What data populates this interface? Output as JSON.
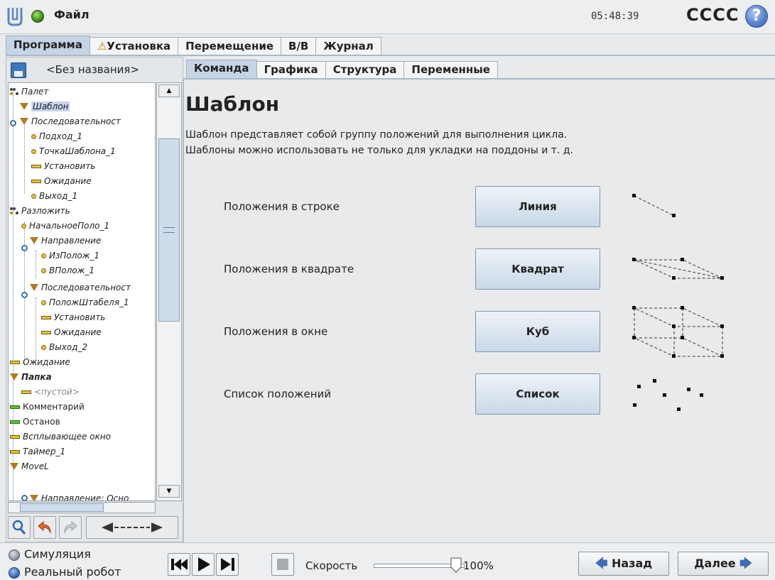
{
  "topbar": {
    "file_menu": "Файл",
    "clock": "05:48:39",
    "robot_name": "CCCC",
    "help": "?"
  },
  "main_tabs": [
    {
      "label": "Программа",
      "active": true
    },
    {
      "label": "Установка",
      "warning": true
    },
    {
      "label": "Перемещение"
    },
    {
      "label": "В/В"
    },
    {
      "label": "Журнал"
    }
  ],
  "program": {
    "name": "<Без названия>"
  },
  "tree": [
    {
      "label": "Палет",
      "icon": "pallet-icon"
    },
    {
      "label": "Шаблон",
      "icon": "folder-triangle-icon",
      "selected": true
    },
    {
      "label": "Последовательност",
      "icon": "folder-triangle-icon"
    },
    {
      "label": "Подход_1",
      "icon": "waypoint-icon"
    },
    {
      "label": "ТочкаШаблона_1",
      "icon": "waypoint-icon"
    },
    {
      "label": "Установить",
      "icon": "command-bar-icon"
    },
    {
      "label": "Ожидание",
      "icon": "command-bar-icon"
    },
    {
      "label": "Выход_1",
      "icon": "waypoint-icon"
    },
    {
      "label": "Разложить",
      "icon": "pallet-icon"
    },
    {
      "label": "НачальноеПоло_1",
      "icon": "waypoint-icon"
    },
    {
      "label": "Направление",
      "icon": "folder-triangle-icon"
    },
    {
      "label": "ИзПолож_1",
      "icon": "waypoint-icon"
    },
    {
      "label": "ВПолож_1",
      "icon": "waypoint-icon"
    },
    {
      "label": "Последовательност",
      "icon": "folder-triangle-icon"
    },
    {
      "label": "ПоложШтабеля_1",
      "icon": "waypoint-icon"
    },
    {
      "label": "Установить",
      "icon": "command-bar-icon"
    },
    {
      "label": "Ожидание",
      "icon": "command-bar-icon"
    },
    {
      "label": "Выход_2",
      "icon": "waypoint-icon"
    },
    {
      "label": "Ожидание",
      "icon": "command-bar-icon"
    },
    {
      "label": "Папка",
      "icon": "folder-triangle-icon"
    },
    {
      "label": "<пустой>",
      "icon": "command-bar-icon"
    },
    {
      "label": "Комментарий",
      "icon": "comment-bar-icon"
    },
    {
      "label": "Останов",
      "icon": "stop-bar-icon"
    },
    {
      "label": "Всплывающее окно",
      "icon": "command-bar-icon"
    },
    {
      "label": "Таймер_1",
      "icon": "command-bar-icon"
    },
    {
      "label": "MoveL",
      "icon": "folder-triangle-icon"
    },
    {
      "label": "Направление: Осно",
      "icon": "folder-triangle-icon"
    }
  ],
  "sub_tabs": [
    {
      "label": "Команда",
      "active": true
    },
    {
      "label": "Графика"
    },
    {
      "label": "Структура"
    },
    {
      "label": "Переменные"
    }
  ],
  "content": {
    "title": "Шаблон",
    "desc1": "Шаблон представляет собой группу положений для выполнения цикла.",
    "desc2": "Шаблоны можно использовать не только для укладки на поддоны и т. д.",
    "rows": [
      {
        "label": "Положения в строке",
        "button": "Линия",
        "diagram": "line-pattern-icon"
      },
      {
        "label": "Положения в квадрате",
        "button": "Квадрат",
        "diagram": "square-pattern-icon"
      },
      {
        "label": "Положения в окне",
        "button": "Куб",
        "diagram": "cube-pattern-icon"
      },
      {
        "label": "Список положений",
        "button": "Список",
        "diagram": "list-pattern-icon"
      }
    ]
  },
  "bottom": {
    "mode_sim": "Симуляция",
    "mode_real": "Реальный робот",
    "speed_label": "Скорость",
    "speed_value": "100%",
    "speed_fraction": 1.0,
    "back": "Назад",
    "next": "Далее"
  },
  "colors": {
    "accent": "#c5d5e6",
    "folder": "#b07b21",
    "waypoint": "#e0c043",
    "command": "#e4c634",
    "green": "#59c03a"
  }
}
